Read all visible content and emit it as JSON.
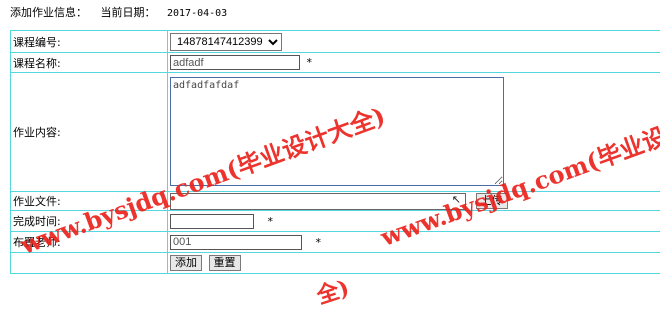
{
  "header": {
    "title": "添加作业信息：",
    "date_label": "当前日期：",
    "date_value": "2017-04-03"
  },
  "form": {
    "course_no_label": "课程编号:",
    "course_no_value": "14878147412399",
    "course_name_label": "课程名称:",
    "course_name_value": "adfadf",
    "content_label": "作业内容:",
    "content_value": "adfadfafdaf",
    "file_label": "作业文件:",
    "upload_button": "上传",
    "deadline_label": "完成时间:",
    "deadline_value": "",
    "teacher_label": "布置老师:",
    "teacher_value": "001",
    "required_mark": "*",
    "add_button": "添加",
    "reset_button": "重置"
  },
  "watermark": {
    "line1": "www.bysjdq.com(毕业设计大全)",
    "line2": "www.bysjdq.com(毕业设计",
    "line3": "全)"
  },
  "colors": {
    "table_border": "#56d6de",
    "watermark": "#ec221b"
  }
}
